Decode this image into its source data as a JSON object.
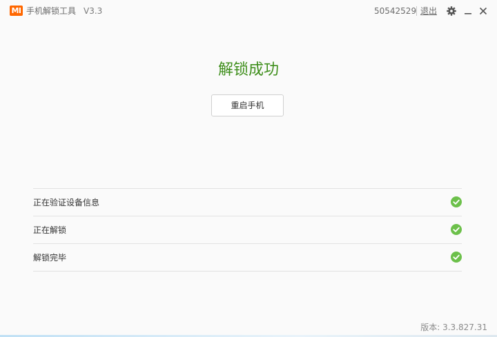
{
  "titlebar": {
    "logo_text": "MI",
    "app_title": "手机解锁工具",
    "version": "V3.3",
    "account_id": "50542529",
    "logout_label": "退出",
    "icons": [
      "gear-icon",
      "minimize-icon",
      "close-icon"
    ]
  },
  "main": {
    "result_title": "解锁成功",
    "reboot_label": "重启手机"
  },
  "steps": [
    {
      "label": "正在验证设备信息",
      "status": "done"
    },
    {
      "label": "正在解锁",
      "status": "done"
    },
    {
      "label": "解锁完毕",
      "status": "done"
    }
  ],
  "footer": {
    "version_text": "版本: 3.3.827.31"
  },
  "colors": {
    "brand": "#ff6700",
    "success_text": "#3e8e1b",
    "check_green": "#6cc04a"
  }
}
